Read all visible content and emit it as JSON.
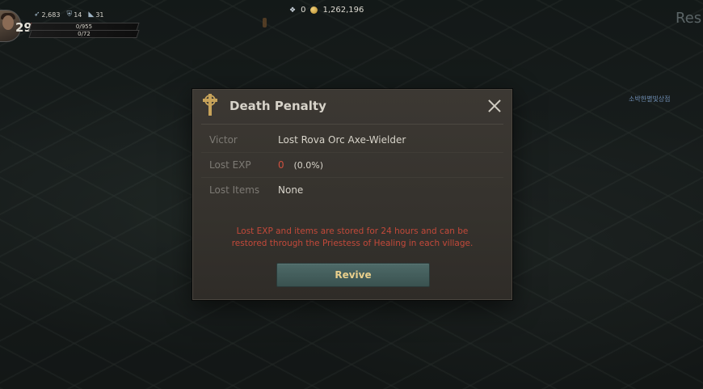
{
  "hud": {
    "level": "29",
    "stat1": "2,683",
    "stat2": "14",
    "stat3": "31",
    "hp": "0/955",
    "mp": "0/72",
    "gems": "0",
    "gold": "1,262,196",
    "rest_label": "Res",
    "right_note": "소박한별빛상점"
  },
  "dialog": {
    "title": "Death Penalty",
    "rows": [
      {
        "label": "Victor",
        "value": "Lost Rova Orc Axe-Wielder"
      },
      {
        "label": "Lost EXP",
        "value": "0",
        "extra": "(0.0%)"
      },
      {
        "label": "Lost Items",
        "value": "None"
      }
    ],
    "notice_line1": "Lost EXP and items are stored for 24 hours and can be",
    "notice_line2": "restored through the Priestess of Healing in each village.",
    "revive_label": "Revive"
  },
  "colors": {
    "accent_gold": "#e9cf8c",
    "warning_red": "#c3493a",
    "button_teal": "#4e6a68"
  }
}
